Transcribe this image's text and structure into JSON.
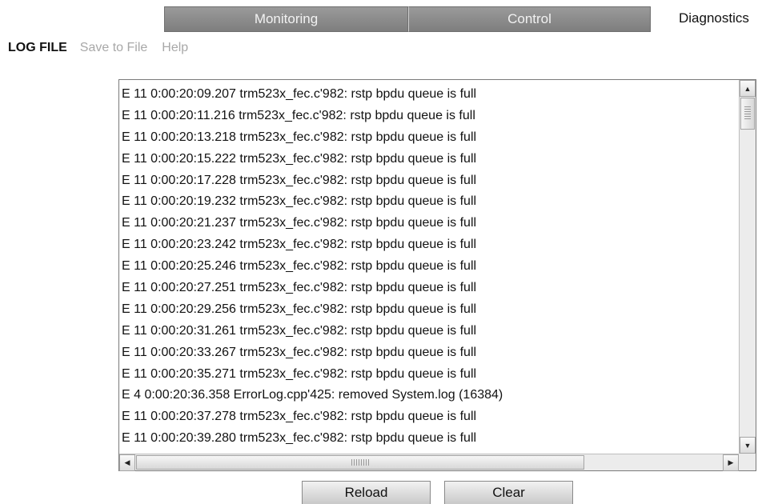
{
  "tabs": {
    "monitoring": "Monitoring",
    "control": "Control",
    "diagnostics": "Diagnostics"
  },
  "submenu": {
    "title": "LOG FILE",
    "save_to_file": "Save to File",
    "help": "Help"
  },
  "log": {
    "lines": [
      "E 11 0:00:20:09.207 trm523x_fec.c'982: rstp bpdu queue is full",
      "E 11 0:00:20:11.216 trm523x_fec.c'982: rstp bpdu queue is full",
      "E 11 0:00:20:13.218 trm523x_fec.c'982: rstp bpdu queue is full",
      "E 11 0:00:20:15.222 trm523x_fec.c'982: rstp bpdu queue is full",
      "E 11 0:00:20:17.228 trm523x_fec.c'982: rstp bpdu queue is full",
      "E 11 0:00:20:19.232 trm523x_fec.c'982: rstp bpdu queue is full",
      "E 11 0:00:20:21.237 trm523x_fec.c'982: rstp bpdu queue is full",
      "E 11 0:00:20:23.242 trm523x_fec.c'982: rstp bpdu queue is full",
      "E 11 0:00:20:25.246 trm523x_fec.c'982: rstp bpdu queue is full",
      "E 11 0:00:20:27.251 trm523x_fec.c'982: rstp bpdu queue is full",
      "E 11 0:00:20:29.256 trm523x_fec.c'982: rstp bpdu queue is full",
      "E 11 0:00:20:31.261 trm523x_fec.c'982: rstp bpdu queue is full",
      "E 11 0:00:20:33.267 trm523x_fec.c'982: rstp bpdu queue is full",
      "E 11 0:00:20:35.271 trm523x_fec.c'982: rstp bpdu queue is full",
      "E  4  0:00:20:36.358 ErrorLog.cpp'425: removed System.log (16384)",
      "E 11 0:00:20:37.278 trm523x_fec.c'982: rstp bpdu queue is full",
      "E 11 0:00:20:39.280 trm523x_fec.c'982: rstp bpdu queue is full"
    ]
  },
  "buttons": {
    "reload": "Reload",
    "clear": "Clear"
  },
  "icons": {
    "scroll_up": "arrow-up-icon",
    "scroll_down": "arrow-down-icon",
    "scroll_left": "arrow-left-icon",
    "scroll_right": "arrow-right-icon"
  }
}
